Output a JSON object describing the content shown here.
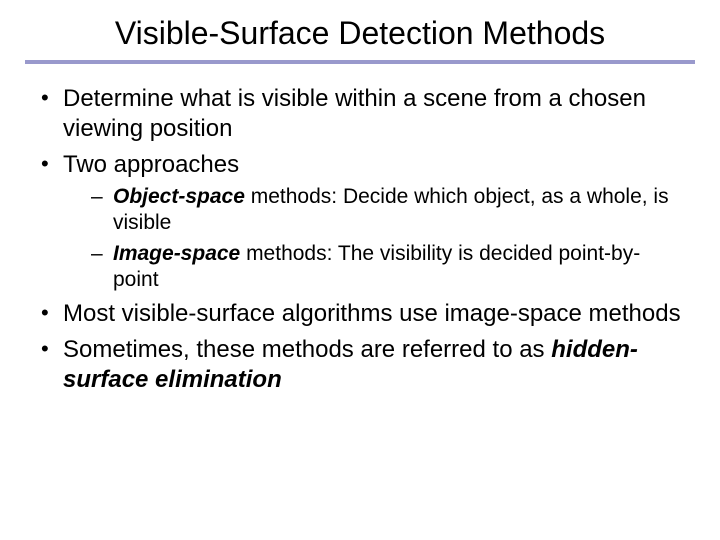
{
  "title": "Visible-Surface Detection Methods",
  "bullets": {
    "b1": "Determine what is visible within a scene from a chosen viewing position",
    "b2": "Two approaches",
    "b3": "Most visible-surface algorithms use image-space methods",
    "b4_pre": "Sometimes, these methods are referred to as ",
    "b4_bold": "hidden-surface elimination"
  },
  "subs": {
    "s1_bold": "Object-space",
    "s1_rest": " methods: Decide which object, as a whole, is visible",
    "s2_bold": "Image-space",
    "s2_rest": " methods: The visibility is decided point-by-point"
  }
}
